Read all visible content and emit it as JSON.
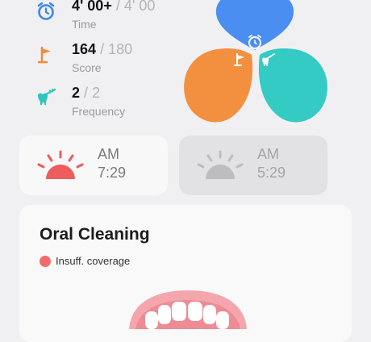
{
  "stats": [
    {
      "icon": "alarm-clock-icon",
      "value": "4' 00+",
      "max": "4' 00",
      "label": "Time",
      "color": "#3a86f0"
    },
    {
      "icon": "flag-icon",
      "value": "164",
      "max": "180",
      "label": "Score",
      "color": "#f08c3c"
    },
    {
      "icon": "toothbrush-icon",
      "value": "2",
      "max": "2",
      "label": "Frequency",
      "color": "#2fc6c0"
    }
  ],
  "separator": "/",
  "petals": {
    "blue": "#4a8ef2",
    "orange": "#f29040",
    "teal": "#33cbc3"
  },
  "sessions": [
    {
      "period": "AM",
      "time": "7:29",
      "sun_color": "#ee5c5c",
      "active": true
    },
    {
      "period": "AM",
      "time": "5:29",
      "sun_color": "#bdbdc0",
      "active": false
    }
  ],
  "oral_cleaning": {
    "title": "Oral Cleaning",
    "legend_label": "Insuff. coverage",
    "legend_color": "#ee6e6e"
  }
}
